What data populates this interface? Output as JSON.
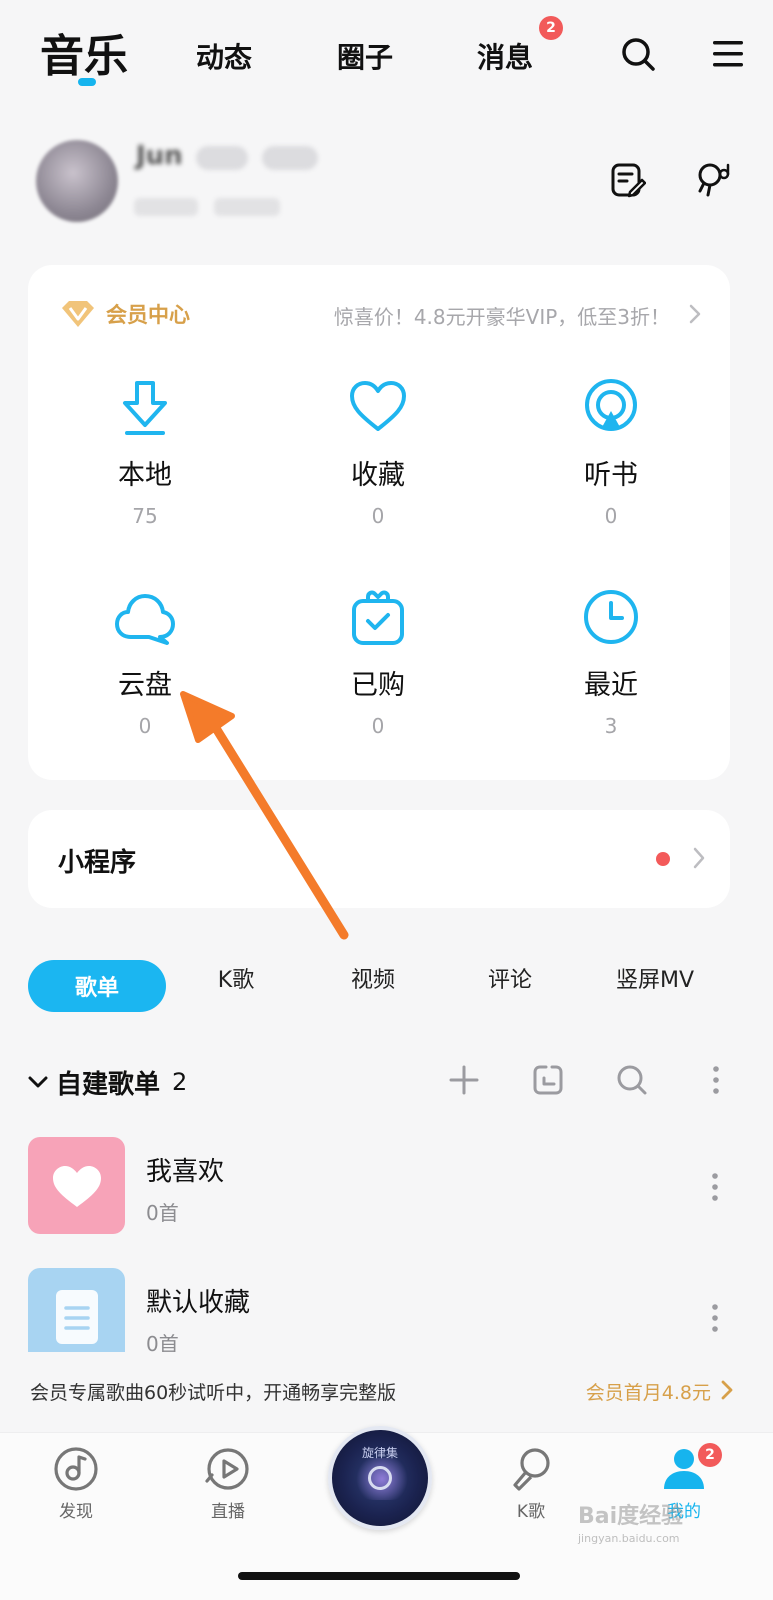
{
  "topnav": {
    "tabs": [
      "音乐",
      "动态",
      "圈子",
      "消息"
    ],
    "msg_badge": "2",
    "search_icon": "search-icon",
    "menu_icon": "menu-icon"
  },
  "profile": {
    "name": "Jun",
    "edit_icon": "edit-note-icon",
    "mic_icon": "singer-mic-icon"
  },
  "vip": {
    "title": "会员中心",
    "promo": "惊喜价！4.8元开豪华VIP，低至3折！",
    "accent": "#d7a04a"
  },
  "grid": [
    {
      "label": "本地",
      "count": "75",
      "icon": "download-icon"
    },
    {
      "label": "收藏",
      "count": "0",
      "icon": "heart-icon"
    },
    {
      "label": "听书",
      "count": "0",
      "icon": "audiobook-icon"
    },
    {
      "label": "云盘",
      "count": "0",
      "icon": "cloud-icon"
    },
    {
      "label": "已购",
      "count": "0",
      "icon": "purchased-bag-icon"
    },
    {
      "label": "最近",
      "count": "3",
      "icon": "clock-icon"
    }
  ],
  "mini_program": {
    "title": "小程序"
  },
  "content_tabs": [
    "歌单",
    "K歌",
    "视频",
    "评论",
    "竖屏MV"
  ],
  "playlist_section": {
    "title": "自建歌单",
    "count": "2",
    "items": [
      {
        "name": "我喜欢",
        "sub": "0首",
        "color": "#f7a3b8"
      },
      {
        "name": "默认收藏",
        "sub": "0首",
        "color": "#a8d4f2"
      }
    ]
  },
  "trial": {
    "text": "会员专属歌曲60秒试听中，开通畅享完整版",
    "link": "会员首月4.8元"
  },
  "player": {
    "disc_text": "旋律集"
  },
  "bottom_nav": [
    {
      "label": "发现",
      "icon": "music-note-disc-icon"
    },
    {
      "label": "直播",
      "icon": "live-play-icon"
    },
    {
      "label": "K歌",
      "icon": "karaoke-mic-icon"
    },
    {
      "label": "我的",
      "icon": "user-icon",
      "badge": "2"
    }
  ],
  "watermark": {
    "main": "Bai度经验",
    "sub": "jingyan.baidu.com"
  },
  "colors": {
    "brand": "#16b4ee",
    "badge": "#f25a5a",
    "annotation_arrow": "#f47b2a"
  }
}
